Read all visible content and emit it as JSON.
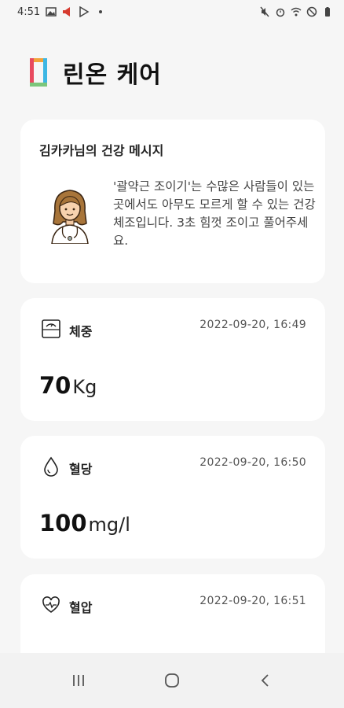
{
  "status_bar": {
    "time": "4:51",
    "left_icons": [
      "gallery-icon",
      "megaphone-icon",
      "play-store-icon",
      "dot-icon"
    ],
    "right_icons": [
      "mute-icon",
      "alarm-icon",
      "wifi-icon",
      "dnd-icon",
      "battery-icon"
    ]
  },
  "header": {
    "title": "린온 케어",
    "logo_colors": [
      "#f2a33a",
      "#e84a5f",
      "#3db7e4",
      "#7bc67b"
    ]
  },
  "message_card": {
    "title": "김카카님의 건강 메시지",
    "body": "'괄약근 조이기'는 수많은 사람들이 있는 곳에서도 아무도 모르게 할 수 있는 건강 체조입니다. 3초 힘껏 조이고 풀어주세요."
  },
  "metrics": {
    "weight": {
      "label": "체중",
      "timestamp": "2022-09-20, 16:49",
      "value": "70",
      "unit": "Kg",
      "icon": "scale-icon"
    },
    "blood_sugar": {
      "label": "혈당",
      "timestamp": "2022-09-20, 16:50",
      "value": "100",
      "unit": "mg/l",
      "icon": "drop-icon"
    },
    "blood_pressure": {
      "label": "혈압",
      "timestamp": "2022-09-20, 16:51",
      "icon": "heart-pulse-icon"
    }
  },
  "nav_bar": {
    "buttons": [
      "recent-apps-icon",
      "home-icon",
      "back-icon"
    ]
  }
}
